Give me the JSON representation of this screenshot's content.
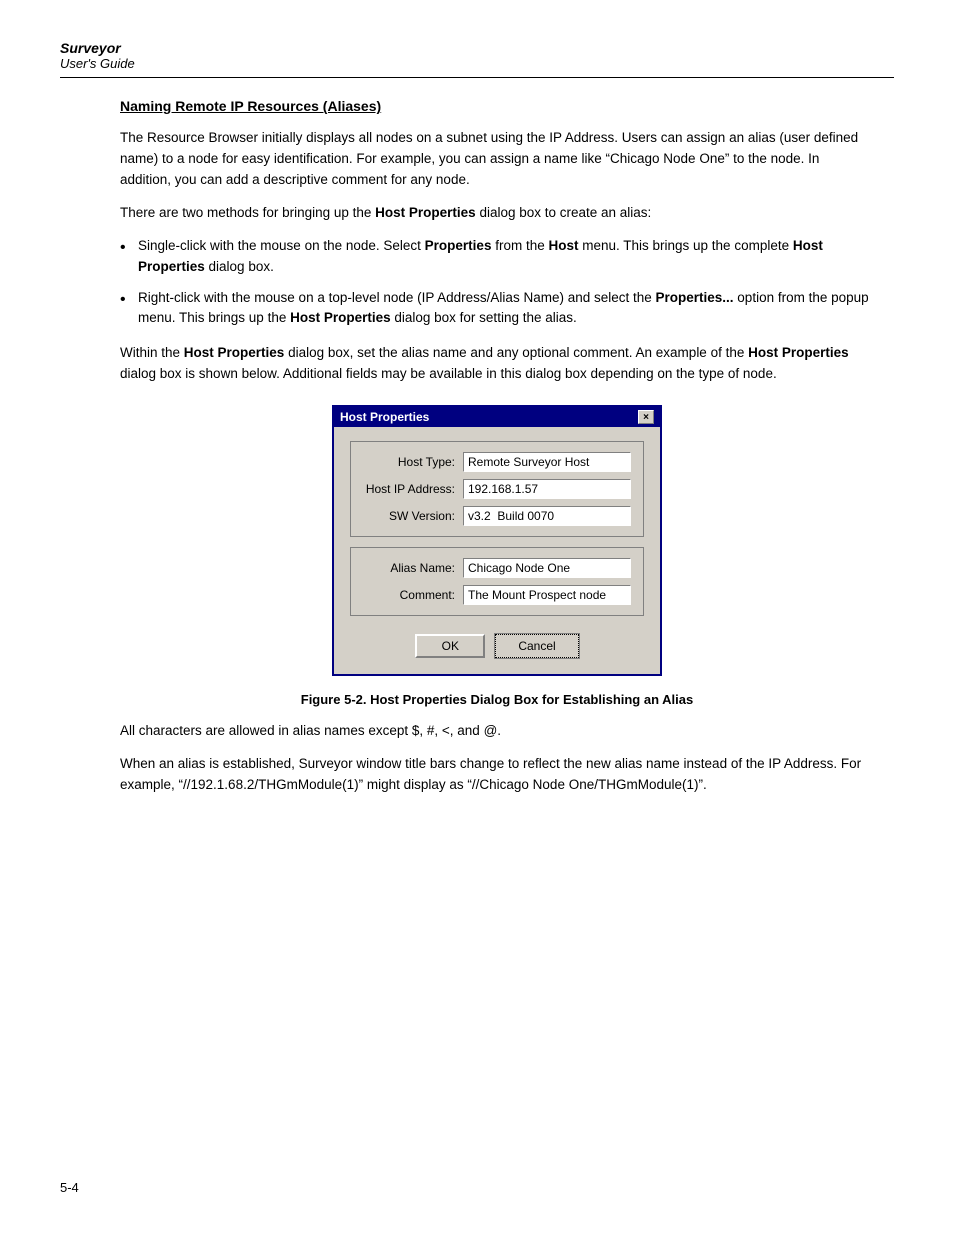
{
  "header": {
    "title": "Surveyor",
    "subtitle": "User's Guide"
  },
  "section": {
    "heading": "Naming Remote IP Resources (Aliases)",
    "intro_p1": "The Resource Browser initially displays all nodes on a subnet using the IP Address. Users can assign an alias (user defined name) to a node for easy identification. For example, you can assign a name like “Chicago Node One” to the node. In addition, you can add a descriptive comment for any node.",
    "intro_p2": "There are two methods for bringing up the ",
    "intro_p2_bold": "Host Properties",
    "intro_p2_cont": " dialog box to create an alias:",
    "bullet1_pre": "Single-click with the mouse on the node. Select ",
    "bullet1_bold1": "Properties",
    "bullet1_mid": " from the ",
    "bullet1_bold2": "Host",
    "bullet1_cont": " menu. This brings up the complete ",
    "bullet1_bold3": "Host Properties",
    "bullet1_end": " dialog box.",
    "bullet2_pre": "Right-click with the mouse on a top-level node (IP Address/Alias Name) and select the ",
    "bullet2_bold1": "Properties...",
    "bullet2_mid": " option from the popup menu. This brings up the ",
    "bullet2_bold2": "Host Properties",
    "bullet2_end": " dialog box for setting the alias.",
    "summary_pre": "Within the ",
    "summary_bold1": "Host Properties",
    "summary_mid": " dialog box, set the alias name and any optional comment. An example of the ",
    "summary_bold2": "Host Properties",
    "summary_end": " dialog box is shown below. Additional fields may be available in this dialog box depending on the type of node.",
    "figure_caption": "Figure 5-2.  Host Properties Dialog Box for Establishing an Alias",
    "allowed_chars": " All characters are allowed in alias names except $, #, <, and @.",
    "alias_desc": "When an alias is established, Surveyor window title bars change to reflect the new alias name instead of the IP Address. For example, “//192.1.68.2/THGmModule(1)” might display as “//Chicago Node One/THGmModule(1)”."
  },
  "dialog": {
    "title": "Host Properties",
    "close_label": "×",
    "fields": {
      "host_type_label": "Host Type:",
      "host_type_value": "Remote Surveyor Host",
      "host_ip_label": "Host IP Address:",
      "host_ip_value": "192.168.1.57",
      "sw_version_label": "SW Version:",
      "sw_version_value": "v3.2  Build 0070",
      "alias_label": "Alias Name:",
      "alias_value": "Chicago Node One",
      "comment_label": "Comment:",
      "comment_value": "The Mount Prospect node"
    },
    "ok_label": "OK",
    "cancel_label": "Cancel"
  },
  "page_number": "5-4"
}
